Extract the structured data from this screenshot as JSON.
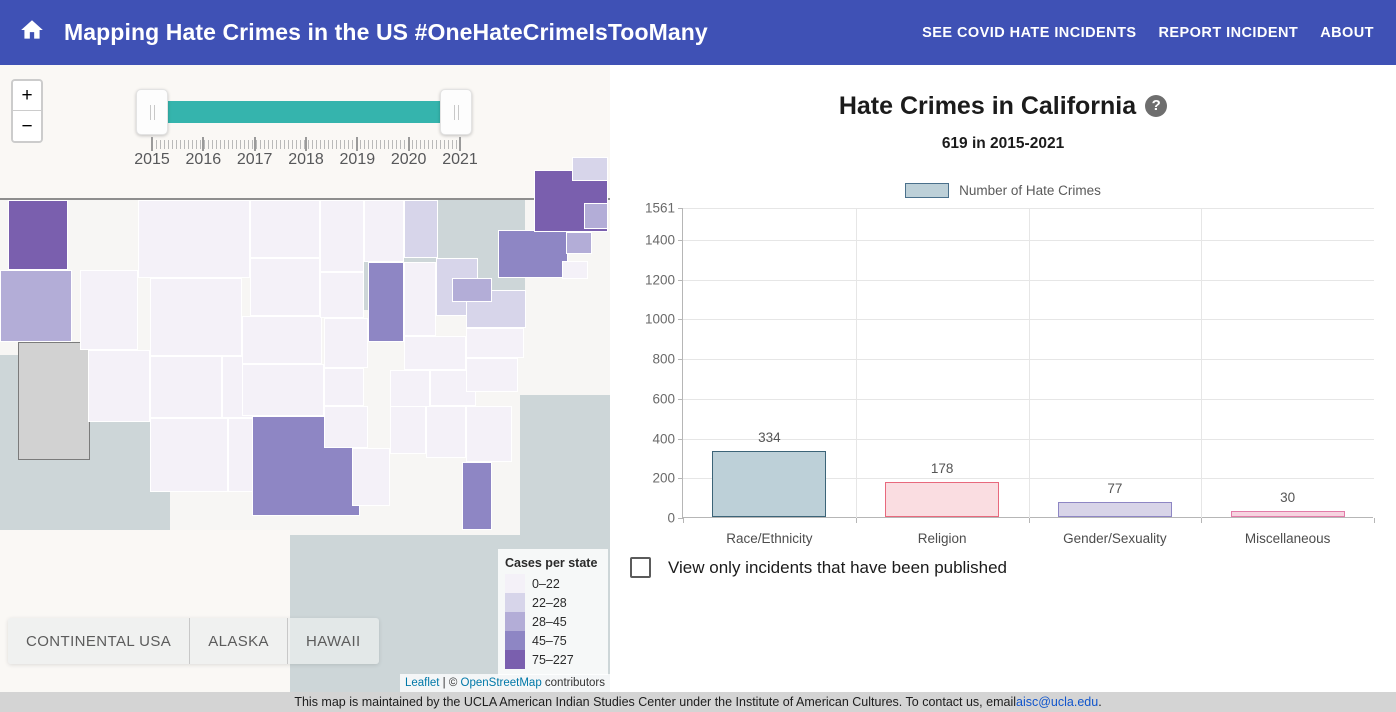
{
  "header": {
    "home_icon": "home-icon",
    "title": "Mapping Hate Crimes in the US #OneHateCrimeIsTooMany",
    "nav": [
      {
        "label": "SEE COVID HATE INCIDENTS"
      },
      {
        "label": "REPORT INCIDENT"
      },
      {
        "label": "ABOUT"
      }
    ],
    "bg_color": "#3f51b5"
  },
  "map": {
    "zoom_in_label": "+",
    "zoom_out_label": "−",
    "year_slider": {
      "min_year": 2015,
      "max_year": 2021,
      "selected_start": 2015,
      "selected_end": 2021,
      "tick_labels": [
        "2015",
        "2016",
        "2017",
        "2018",
        "2019",
        "2020",
        "2021"
      ],
      "fill_color": "#35b4ad"
    },
    "legend": {
      "title": "Cases per state",
      "bins": [
        {
          "label": "0–22",
          "color": "#f4f1f8"
        },
        {
          "label": "22–28",
          "color": "#d7d5ea"
        },
        {
          "label": "28–45",
          "color": "#b3add7"
        },
        {
          "label": "45–75",
          "color": "#8e86c4"
        },
        {
          "label": "75–227",
          "color": "#7a5fae"
        }
      ]
    },
    "region_tabs": [
      {
        "label": "CONTINENTAL USA",
        "selected": true
      },
      {
        "label": "ALASKA",
        "selected": false
      },
      {
        "label": "HAWAII",
        "selected": false
      }
    ],
    "selected_state": "California",
    "attribution": {
      "leaflet": "Leaflet",
      "separator": " | © ",
      "osm": "OpenStreetMap",
      "suffix": " contributors"
    }
  },
  "panel": {
    "title": "Hate Crimes in California",
    "help_icon": "question-mark-icon",
    "help_glyph": "?",
    "subtitle": "619 in 2015-2021",
    "checkbox_label": "View only incidents that have been published",
    "checkbox_checked": false
  },
  "chart_data": {
    "type": "bar",
    "title": "Hate Crimes in California",
    "subtitle": "619 in 2015-2021",
    "xlabel": "",
    "ylabel": "",
    "ylim": [
      0,
      1561
    ],
    "grid": true,
    "legend_position": "top-center",
    "legend_entries": [
      "Number of Hate Crimes"
    ],
    "categories": [
      "Race/Ethnicity",
      "Religion",
      "Gender/Sexuality",
      "Miscellaneous"
    ],
    "values": [
      334,
      178,
      77,
      30
    ],
    "value_labels": [
      "334",
      "178",
      "77",
      "30"
    ],
    "bar_fill_colors": [
      "#bdd0d8",
      "#fadde1",
      "#d8d4e8",
      "#f7d3e0"
    ],
    "bar_border_colors": [
      "#3c6478",
      "#e8697d",
      "#8e86c4",
      "#e27ba8"
    ],
    "y_ticks": [
      0,
      200,
      400,
      600,
      800,
      1000,
      1200,
      1400,
      1561
    ],
    "y_tick_labels": [
      "0",
      "200",
      "400",
      "600",
      "800",
      "1000",
      "1200",
      "1400",
      "1561"
    ]
  },
  "footer": {
    "text_before": "This map is maintained by the UCLA American Indian Studies Center under the Institute of American Cultures. To contact us, email ",
    "email": "aisc@ucla.edu",
    "text_after": "."
  }
}
